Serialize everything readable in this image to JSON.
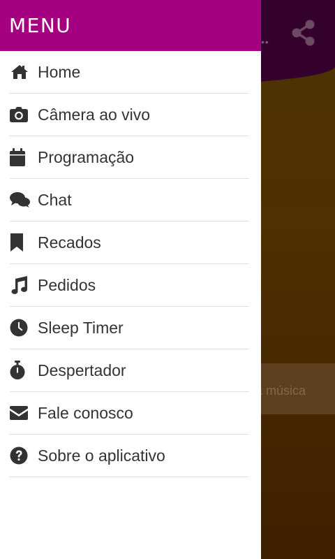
{
  "drawer": {
    "title": "MENU"
  },
  "menu": {
    "items": [
      {
        "label": "Home",
        "icon": "home-icon"
      },
      {
        "label": "Câmera ao vivo",
        "icon": "camera-icon"
      },
      {
        "label": "Programação",
        "icon": "calendar-icon"
      },
      {
        "label": "Chat",
        "icon": "chat-icon"
      },
      {
        "label": "Recados",
        "icon": "bookmark-icon"
      },
      {
        "label": "Pedidos",
        "icon": "music-note-icon"
      },
      {
        "label": "Sleep Timer",
        "icon": "clock-icon"
      },
      {
        "label": "Despertador",
        "icon": "stopwatch-icon"
      },
      {
        "label": "Fale conosco",
        "icon": "envelope-icon"
      },
      {
        "label": "Sobre o aplicativo",
        "icon": "question-circle-icon"
      }
    ]
  },
  "background": {
    "strip_text": "a música",
    "share_icon": "share-icon"
  },
  "colors": {
    "accent": "#a5007f",
    "header_bg": "#34002c",
    "drawer_bg": "#ffffff",
    "text": "#333333"
  }
}
